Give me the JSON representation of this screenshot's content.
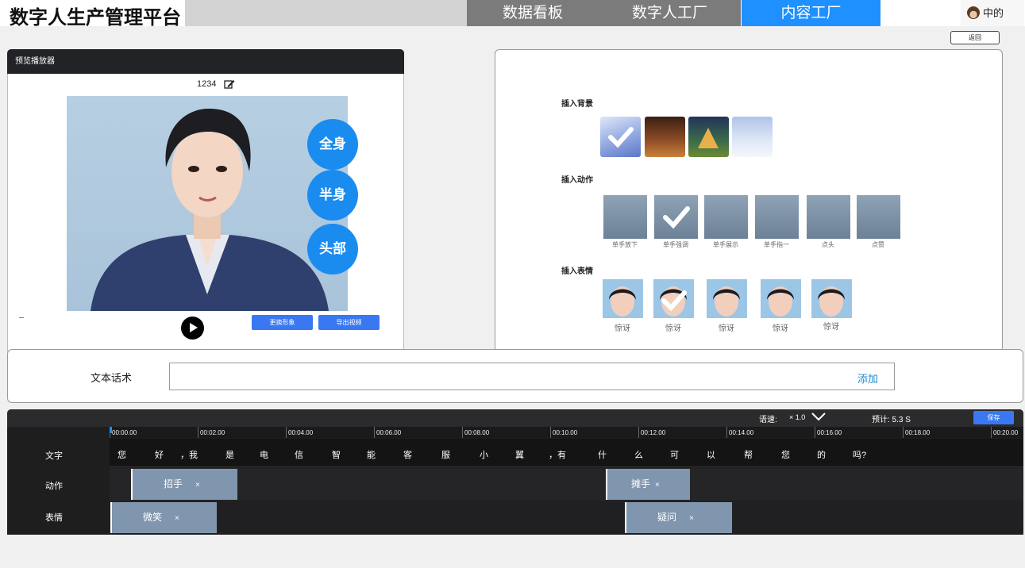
{
  "header": {
    "app_title": "数字人生产管理平台",
    "nav_tabs": [
      {
        "label": "数据看板",
        "active": false
      },
      {
        "label": "数字人工厂",
        "active": false
      },
      {
        "label": "内容工厂",
        "active": true
      }
    ],
    "user_name": "中的",
    "back_label": "返回"
  },
  "preview": {
    "panel_title": "预览播放器",
    "video_title": "1234",
    "shot_buttons": [
      "全身",
      "半身",
      "头部"
    ],
    "change_look_label": "更换形象",
    "export_label": "导出视频"
  },
  "assets": {
    "background_label": "插入背景",
    "backgrounds": [
      {
        "name": "snow-mountain",
        "selected": true
      },
      {
        "name": "cozy-room",
        "selected": false
      },
      {
        "name": "night-tent",
        "selected": false
      },
      {
        "name": "snow-house",
        "selected": false
      }
    ],
    "action_label": "插入动作",
    "actions": [
      {
        "label": "单手放下",
        "selected": false
      },
      {
        "label": "单手强调",
        "selected": true
      },
      {
        "label": "单手展示",
        "selected": false
      },
      {
        "label": "单手指一",
        "selected": false
      },
      {
        "label": "点头",
        "selected": false
      },
      {
        "label": "点赞",
        "selected": false
      }
    ],
    "expression_label": "插入表情",
    "expressions": [
      {
        "label": "惊讶",
        "selected": false
      },
      {
        "label": "惊讶",
        "selected": true
      },
      {
        "label": "惊讶",
        "selected": false
      },
      {
        "label": "惊讶",
        "selected": false
      },
      {
        "label": "惊讶",
        "selected": false
      }
    ]
  },
  "script_bar": {
    "label": "文本话术",
    "value": "",
    "add_label": "添加"
  },
  "timeline": {
    "speed_label": "语速:",
    "speed_value": "× 1.0",
    "estimate_label": "预计: 5.3 S",
    "save_label": "保存",
    "ticks": [
      "00:00.00",
      "00:02.00",
      "00:04.00",
      "00:06.00",
      "00:08.00",
      "00:10.00",
      "00:12.00",
      "00:14.00",
      "00:16.00",
      "00:18.00",
      "00:20.00"
    ],
    "row_labels": [
      "文字",
      "动作",
      "表情"
    ],
    "text_chars": [
      "您",
      "好",
      "，我",
      "是",
      "电",
      "信",
      "智",
      "能",
      "客",
      "服",
      "小",
      "翼",
      "，有",
      "什",
      "么",
      "可",
      "以",
      "帮",
      "您",
      "的",
      "吗?"
    ],
    "action_clips": [
      {
        "label": "招手",
        "close": "×"
      },
      {
        "label": "摊手",
        "close": "×"
      }
    ],
    "expression_clips": [
      {
        "label": "微笑",
        "close": "×"
      },
      {
        "label": "疑问",
        "close": "×"
      }
    ]
  }
}
